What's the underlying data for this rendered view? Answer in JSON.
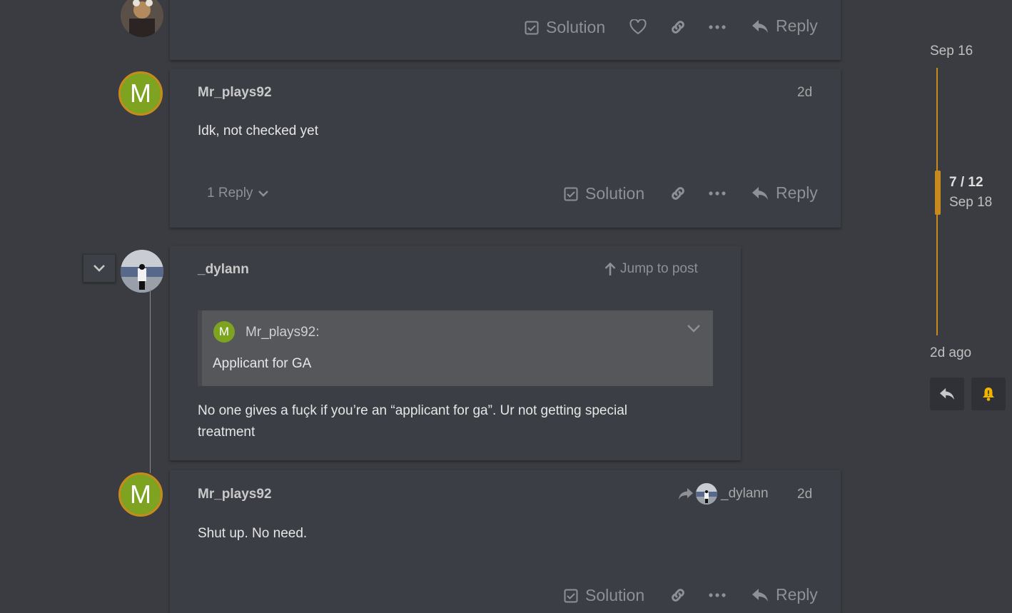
{
  "colors": {
    "background": "#3a3c41",
    "card": "#3b3e44",
    "accent": "#c88a1d",
    "avatar_green": "#7ea321",
    "muted": "#8e9096"
  },
  "actions": {
    "solution": "Solution",
    "reply": "Reply"
  },
  "posts": [
    {
      "username": "Mr_plays92",
      "avatar_letter": "M",
      "date": "2d",
      "body": "Idk, not checked yet",
      "replies_label": "1 Reply"
    },
    {
      "username": "_dylann",
      "jump_label": "Jump to post",
      "quote": {
        "avatar_letter": "M",
        "author": "Mr_plays92:",
        "text": "Applicant for GA"
      },
      "body": "No one gives a fuçk if you’re an “applicant for ga”. Ur not getting special treatment"
    },
    {
      "username": "Mr_plays92",
      "avatar_letter": "M",
      "reply_to": "_dylann",
      "date": "2d",
      "body": "Shut up. No need."
    }
  ],
  "timeline": {
    "start_date": "Sep 16",
    "position": "7 / 12",
    "current_date": "Sep 18",
    "end_date": "2d ago",
    "handle_fraction": 0.58
  },
  "icons": [
    "checkbox-icon",
    "heart-icon",
    "link-icon",
    "ellipsis-icon",
    "reply-icon",
    "chevron-down-icon",
    "arrow-up-icon",
    "share-icon",
    "bell-icon"
  ]
}
